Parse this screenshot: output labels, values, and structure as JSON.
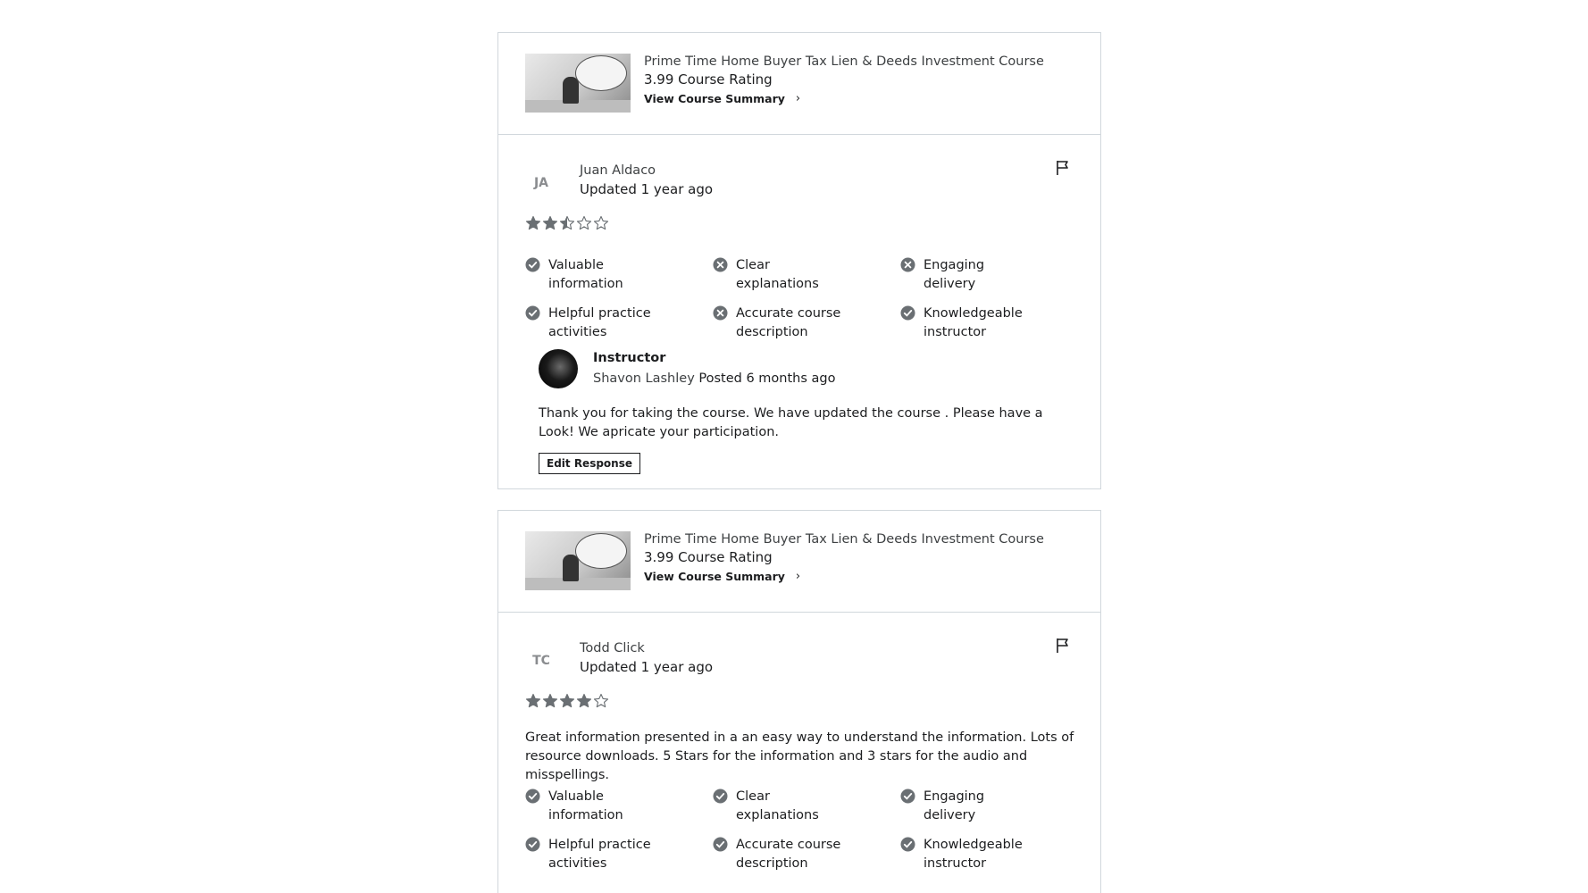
{
  "colors": {
    "icon": "#6a6f73",
    "border": "#d1d7dc",
    "text": "#1c1d1f"
  },
  "reviews": [
    {
      "course": {
        "title": "Prime Time Home Buyer Tax Lien & Deeds Investment Course",
        "rating_text": "3.99 Course Rating",
        "link_label": "View Course Summary",
        "link_icon": "chevron-right-icon"
      },
      "reviewer": {
        "initials": "JA",
        "name": "Juan Aldaco",
        "date": "Updated 1 year ago"
      },
      "rating": 2.5,
      "text": "",
      "aspects": [
        {
          "label": "Valuable information",
          "status": "yes"
        },
        {
          "label": "Clear explanations",
          "status": "no"
        },
        {
          "label": "Engaging delivery",
          "status": "no"
        },
        {
          "label": "Helpful practice activities",
          "status": "yes"
        },
        {
          "label": "Accurate course description",
          "status": "no"
        },
        {
          "label": "Knowledgeable instructor",
          "status": "yes"
        }
      ],
      "response": {
        "role": "Instructor",
        "name": "Shavon Lashley",
        "posted": "Posted 6 months ago",
        "text": "Thank you for taking the course. We have updated the course . Please have a Look! We apricate your participation.",
        "edit_label": "Edit Response"
      }
    },
    {
      "course": {
        "title": "Prime Time Home Buyer Tax Lien & Deeds Investment Course",
        "rating_text": "3.99 Course Rating",
        "link_label": "View Course Summary",
        "link_icon": "chevron-right-icon"
      },
      "reviewer": {
        "initials": "TC",
        "name": "Todd Click",
        "date": "Updated 1 year ago"
      },
      "rating": 4,
      "text": "Great information presented in a an easy way to understand the information. Lots of resource downloads. 5 Stars for the information and 3 stars for the audio and misspellings.",
      "aspects": [
        {
          "label": "Valuable information",
          "status": "yes"
        },
        {
          "label": "Clear explanations",
          "status": "yes"
        },
        {
          "label": "Engaging delivery",
          "status": "yes"
        },
        {
          "label": "Helpful practice activities",
          "status": "yes"
        },
        {
          "label": "Accurate course description",
          "status": "yes"
        },
        {
          "label": "Knowledgeable instructor",
          "status": "yes"
        }
      ]
    }
  ]
}
